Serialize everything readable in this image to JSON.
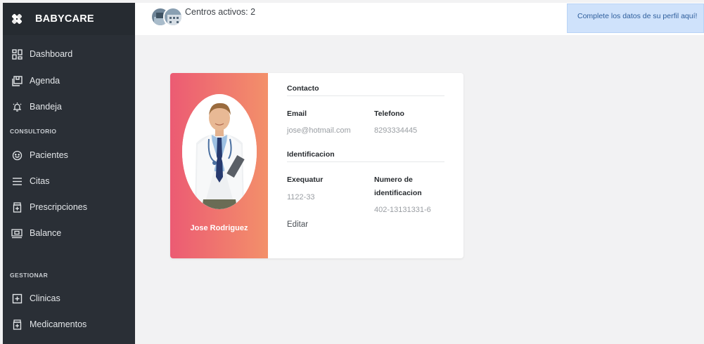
{
  "brand": {
    "name": "BABYCARE",
    "icon": "crossed-bandage-icon"
  },
  "sidebar": {
    "items": [
      {
        "label": "Dashboard",
        "icon": "dashboard-icon"
      },
      {
        "label": "Agenda",
        "icon": "agenda-icon"
      },
      {
        "label": "Bandeja",
        "icon": "bell-icon"
      },
      {
        "label": "Pacientes",
        "icon": "smile-icon"
      },
      {
        "label": "Citas",
        "icon": "list-icon"
      },
      {
        "label": "Prescripciones",
        "icon": "prescription-icon"
      },
      {
        "label": "Balance",
        "icon": "balance-icon"
      },
      {
        "label": "Clinicas",
        "icon": "plus-square-icon"
      },
      {
        "label": "Medicamentos",
        "icon": "medicine-icon"
      }
    ],
    "sections": {
      "consultorio": "CONSULTORIO",
      "gestionar": "GESTIONAR"
    }
  },
  "topbar": {
    "centros_label": "Centros activos: 2",
    "alert": "Complete los datos de su perfil aquí!"
  },
  "profile": {
    "name": "Jose Rodriguez",
    "contact_title": "Contacto",
    "email_label": "Email",
    "email_value": "jose@hotmail.com",
    "phone_label": "Telefono",
    "phone_value": "8293334445",
    "ident_title": "Identificacion",
    "exequatur_label": "Exequatur",
    "exequatur_value": "1122-33",
    "idnum_label_1": "Numero de",
    "idnum_label_2": "identificacion",
    "idnum_value": "402-13131331-6",
    "edit_label": "Editar"
  },
  "colors": {
    "sidebar_bg": "#2a2f36",
    "gradient_start": "#ec5b73",
    "gradient_end": "#f3906a",
    "alert_bg": "#cfe2fb"
  }
}
